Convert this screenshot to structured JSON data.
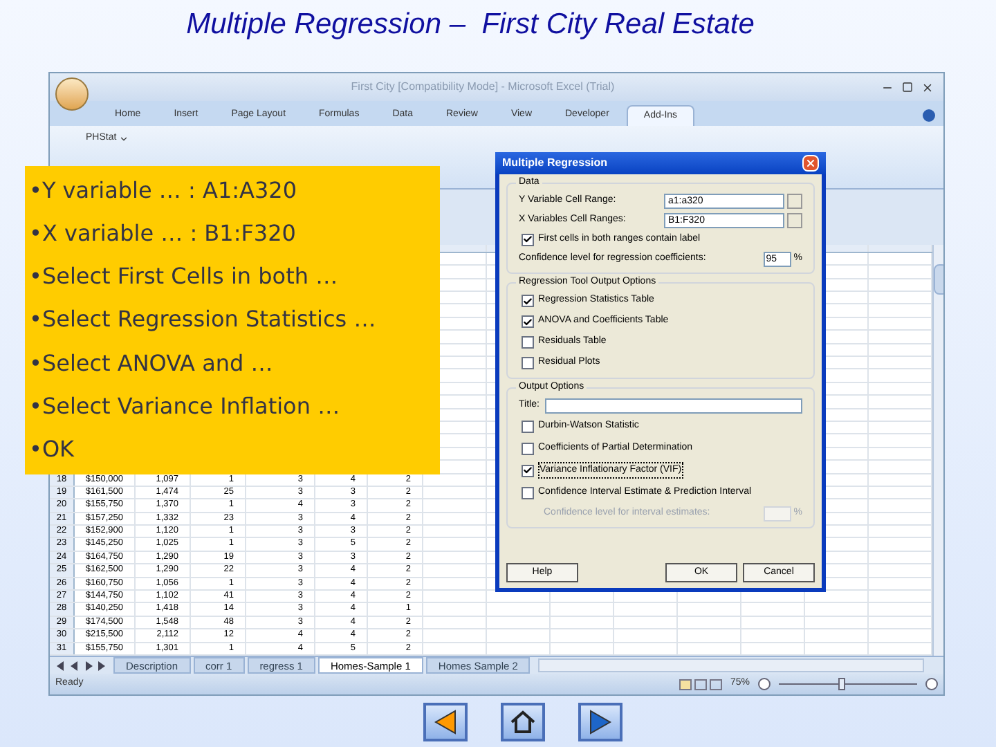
{
  "slide_title": "Multiple Regression –  First City Real Estate",
  "excel": {
    "title": "First City  [Compatibility Mode] - Microsoft Excel (Trial)",
    "ribbon_tabs": [
      {
        "label": "Home",
        "selected": false
      },
      {
        "label": "Insert",
        "selected": false
      },
      {
        "label": "Page Layout",
        "selected": false
      },
      {
        "label": "Formulas",
        "selected": false
      },
      {
        "label": "Data",
        "selected": false
      },
      {
        "label": "Review",
        "selected": false
      },
      {
        "label": "View",
        "selected": false
      },
      {
        "label": "Developer",
        "selected": false
      },
      {
        "label": "Add-Ins",
        "selected": true
      }
    ],
    "addin_menu": "PHStat",
    "rows": [
      {
        "number": "18",
        "cells": [
          "$150,000",
          "1,097",
          "1",
          "3",
          "4",
          "2"
        ]
      },
      {
        "number": "19",
        "cells": [
          "$161,500",
          "1,474",
          "25",
          "3",
          "3",
          "2"
        ]
      },
      {
        "number": "20",
        "cells": [
          "$155,750",
          "1,370",
          "1",
          "4",
          "3",
          "2"
        ]
      },
      {
        "number": "21",
        "cells": [
          "$157,250",
          "1,332",
          "23",
          "3",
          "4",
          "2"
        ]
      },
      {
        "number": "22",
        "cells": [
          "$152,900",
          "1,120",
          "1",
          "3",
          "3",
          "2"
        ]
      },
      {
        "number": "23",
        "cells": [
          "$145,250",
          "1,025",
          "1",
          "3",
          "5",
          "2"
        ]
      },
      {
        "number": "24",
        "cells": [
          "$164,750",
          "1,290",
          "19",
          "3",
          "3",
          "2"
        ]
      },
      {
        "number": "25",
        "cells": [
          "$162,500",
          "1,290",
          "22",
          "3",
          "4",
          "2"
        ]
      },
      {
        "number": "26",
        "cells": [
          "$160,750",
          "1,056",
          "1",
          "3",
          "4",
          "2"
        ]
      },
      {
        "number": "27",
        "cells": [
          "$144,750",
          "1,102",
          "41",
          "3",
          "4",
          "2"
        ]
      },
      {
        "number": "28",
        "cells": [
          "$140,250",
          "1,418",
          "14",
          "3",
          "4",
          "1"
        ]
      },
      {
        "number": "29",
        "cells": [
          "$174,500",
          "1,548",
          "48",
          "3",
          "4",
          "2"
        ]
      },
      {
        "number": "30",
        "cells": [
          "$215,500",
          "2,112",
          "12",
          "4",
          "4",
          "2"
        ]
      },
      {
        "number": "31",
        "cells": [
          "$155,750",
          "1,301",
          "1",
          "4",
          "5",
          "2"
        ]
      }
    ],
    "sheet_tabs": [
      {
        "label": "Description",
        "selected": false
      },
      {
        "label": "corr 1",
        "selected": false
      },
      {
        "label": "regress 1",
        "selected": false
      },
      {
        "label": "Homes-Sample 1",
        "selected": true
      },
      {
        "label": "Homes Sample 2",
        "selected": false
      }
    ],
    "status": "Ready",
    "zoom": {
      "reading": "75%",
      "level": 0.45
    }
  },
  "callout": {
    "items": [
      "•Y variable … : A1:A320",
      "•X variable … : B1:F320",
      "•Select First Cells in both …",
      "•Select Regression Statistics …",
      "•Select ANOVA and …",
      "•Select Variance Inflation …",
      "•OK"
    ]
  },
  "dialog": {
    "title": "Multiple Regression",
    "data_group": {
      "legend": "Data",
      "fields": [
        {
          "label": "Y Variable Cell Range:",
          "value": "a1:a320"
        },
        {
          "label": "X Variables Cell Ranges:",
          "value": "B1:F320"
        }
      ],
      "first_cells": {
        "label": "First cells in both ranges contain label",
        "checked": true
      },
      "confidence": {
        "label": "Confidence level for regression coefficients:",
        "value": "95",
        "unit": "%"
      }
    },
    "output_group": {
      "legend": "Regression Tool Output Options",
      "options": [
        {
          "label": "Regression Statistics Table",
          "checked": true
        },
        {
          "label": "ANOVA and Coefficients Table",
          "checked": true
        },
        {
          "label": "Residuals Table",
          "checked": false
        },
        {
          "label": "Residual Plots",
          "checked": false
        }
      ]
    },
    "output_options": {
      "legend": "Output Options",
      "title_label": "Title:",
      "options": [
        {
          "label": "Durbin-Watson Statistic",
          "checked": false
        },
        {
          "label": "Coefficients of Partial Determination",
          "checked": false
        },
        {
          "label": "Variance Inflationary Factor (VIF)",
          "checked": true
        },
        {
          "label": "Confidence Interval Estimate & Prediction Interval",
          "checked": false
        }
      ],
      "interval": {
        "label": "Confidence level for interval estimates:",
        "unit": "%",
        "disabled": true
      }
    },
    "buttons": [
      "Help",
      "OK",
      "Cancel"
    ]
  },
  "nav_buttons": [
    {
      "kind": "back"
    },
    {
      "kind": "home"
    },
    {
      "kind": "forward"
    }
  ]
}
